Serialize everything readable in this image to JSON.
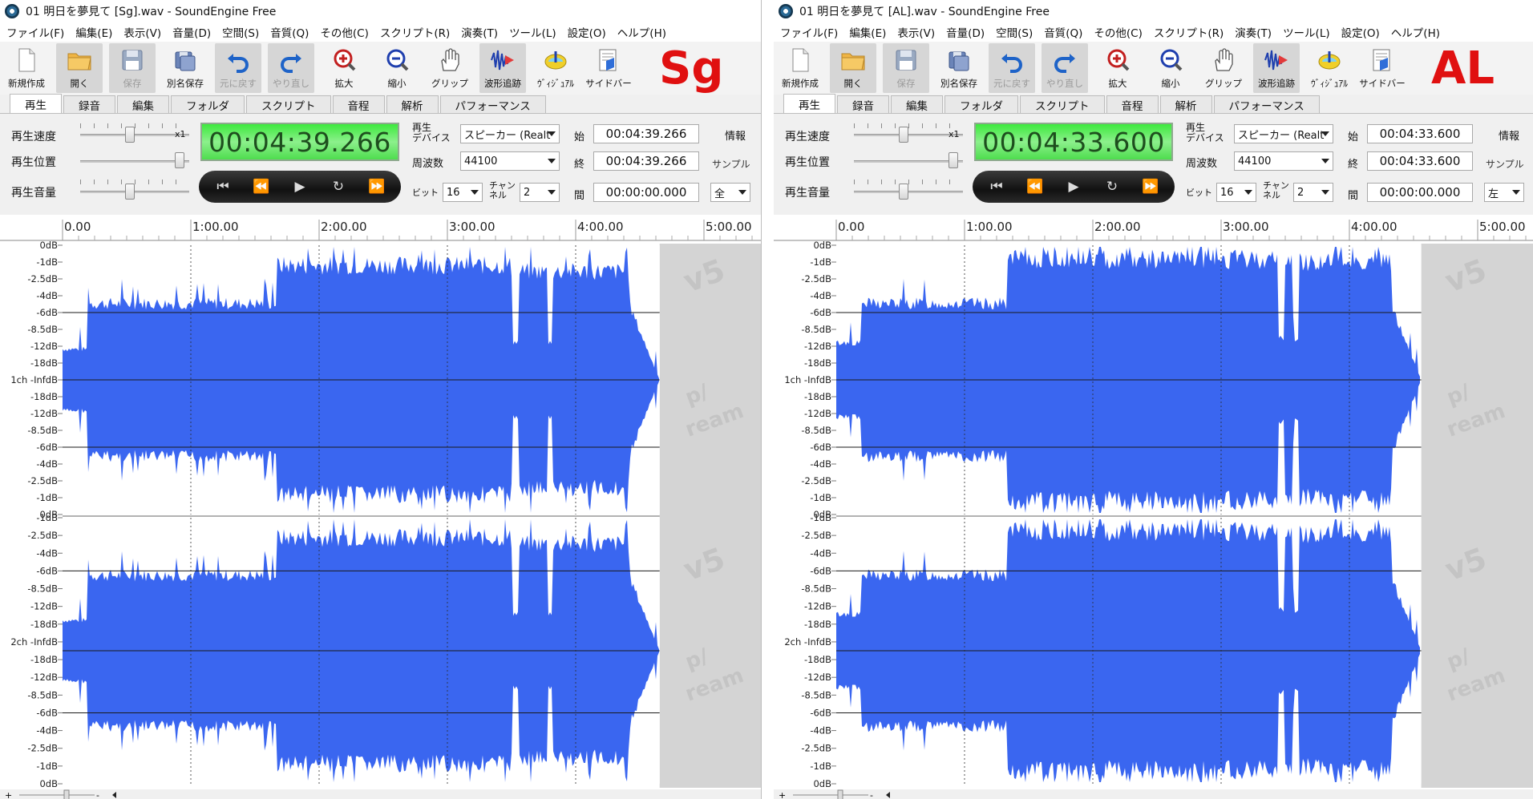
{
  "left": {
    "title": "01 明日を夢見て [Sg].wav - SoundEngine Free",
    "badge": "Sg",
    "lcd": "00:04:39.266",
    "start": "00:04:39.266",
    "end": "00:04:39.266",
    "interval": "00:00:00.000",
    "channel_select": "全"
  },
  "right": {
    "title": "01 明日を夢見て [AL].wav - SoundEngine Free",
    "badge": "AL",
    "lcd": "00:04:33.600",
    "start": "00:04:33.600",
    "end": "00:04:33.600",
    "interval": "00:00:00.000",
    "channel_select": "左"
  },
  "menu": [
    "ファイル(F)",
    "編集(E)",
    "表示(V)",
    "音量(D)",
    "空間(S)",
    "音質(Q)",
    "その他(C)",
    "スクリプト(R)",
    "演奏(T)",
    "ツール(L)",
    "設定(O)",
    "ヘルプ(H)"
  ],
  "toolbar": {
    "new": "新規作成",
    "open": "開く",
    "save": "保存",
    "save_as": "別名保存",
    "undo": "元に戻す",
    "redo": "やり直し",
    "zoom_in": "拡大",
    "zoom_out": "縮小",
    "grip": "グリップ",
    "track": "波形追跡",
    "visual": "ｳﾞｨｼﾞｭｱﾙ",
    "sidebar": "サイドバー"
  },
  "tabs": [
    "再生",
    "録音",
    "編集",
    "フォルダ",
    "スクリプト",
    "音程",
    "解析",
    "パフォーマンス"
  ],
  "controls": {
    "speed_label": "再生速度",
    "position_label": "再生位置",
    "volume_label": "再生音量",
    "speed_mult": "x1",
    "device_label_1": "再生",
    "device_label_2": "デバイス",
    "device_value": "スピーカー (Realt",
    "freq_label": "周波数",
    "freq_value": "44100",
    "bit_label": "ビット",
    "bit_value": "16",
    "chan_label_1": "チャン",
    "chan_label_2": "ネル",
    "chan_value": "2",
    "start_label": "始",
    "end_label": "終",
    "interval_label": "間",
    "info_label": "情報",
    "sample_label": "サンプル"
  },
  "transport": [
    "⏮",
    "⏪",
    "▶",
    "↻",
    "⏩"
  ],
  "timeline": [
    "0.00",
    "1:00.00",
    "2:00.00",
    "3:00.00",
    "4:00.00",
    "5:00.00"
  ],
  "db_labels_ch1": [
    "0dB",
    "-1dB",
    "-2.5dB",
    "-4dB",
    "-6dB",
    "-8.5dB",
    "-12dB",
    "-18dB",
    "1ch -InfdB",
    "-18dB",
    "-12dB",
    "-8.5dB",
    "-6dB",
    "-4dB",
    "-2.5dB",
    "-1dB",
    "0dB"
  ],
  "db_labels_ch2": [
    "-1dB",
    "-2.5dB",
    "-4dB",
    "-6dB",
    "-8.5dB",
    "-12dB",
    "-18dB",
    "2ch -InfdB",
    "-18dB",
    "-12dB",
    "-8.5dB",
    "-6dB",
    "-4dB",
    "-2.5dB",
    "-1dB",
    "0dB"
  ],
  "watermark": [
    "v5",
    "p/",
    "ream"
  ],
  "colors": {
    "waveform": "#3a66f0",
    "lcd": "#52e552",
    "badge": "#e01010",
    "mid_line": "#1a1a1a",
    "gray_bg": "#d4d4d4"
  },
  "waveform": {
    "Sg": {
      "duration_s": 279.266,
      "segments": [
        [
          0,
          12,
          0.25
        ],
        [
          12,
          100,
          0.62
        ],
        [
          100,
          210,
          0.93
        ],
        [
          210,
          265,
          0.88
        ],
        [
          265,
          279.266,
          0.0
        ]
      ],
      "dip_at_s": [
        212,
        228
      ],
      "fade_end_s": 279.266
    },
    "AL": {
      "duration_s": 273.6,
      "segments": [
        [
          0,
          12,
          0.3
        ],
        [
          12,
          80,
          0.62
        ],
        [
          80,
          210,
          0.98
        ],
        [
          210,
          265,
          0.96
        ],
        [
          265,
          273.6,
          0.0
        ]
      ],
      "dip_at_s": [
        208,
        215
      ],
      "fade_end_s": 273.6
    }
  }
}
